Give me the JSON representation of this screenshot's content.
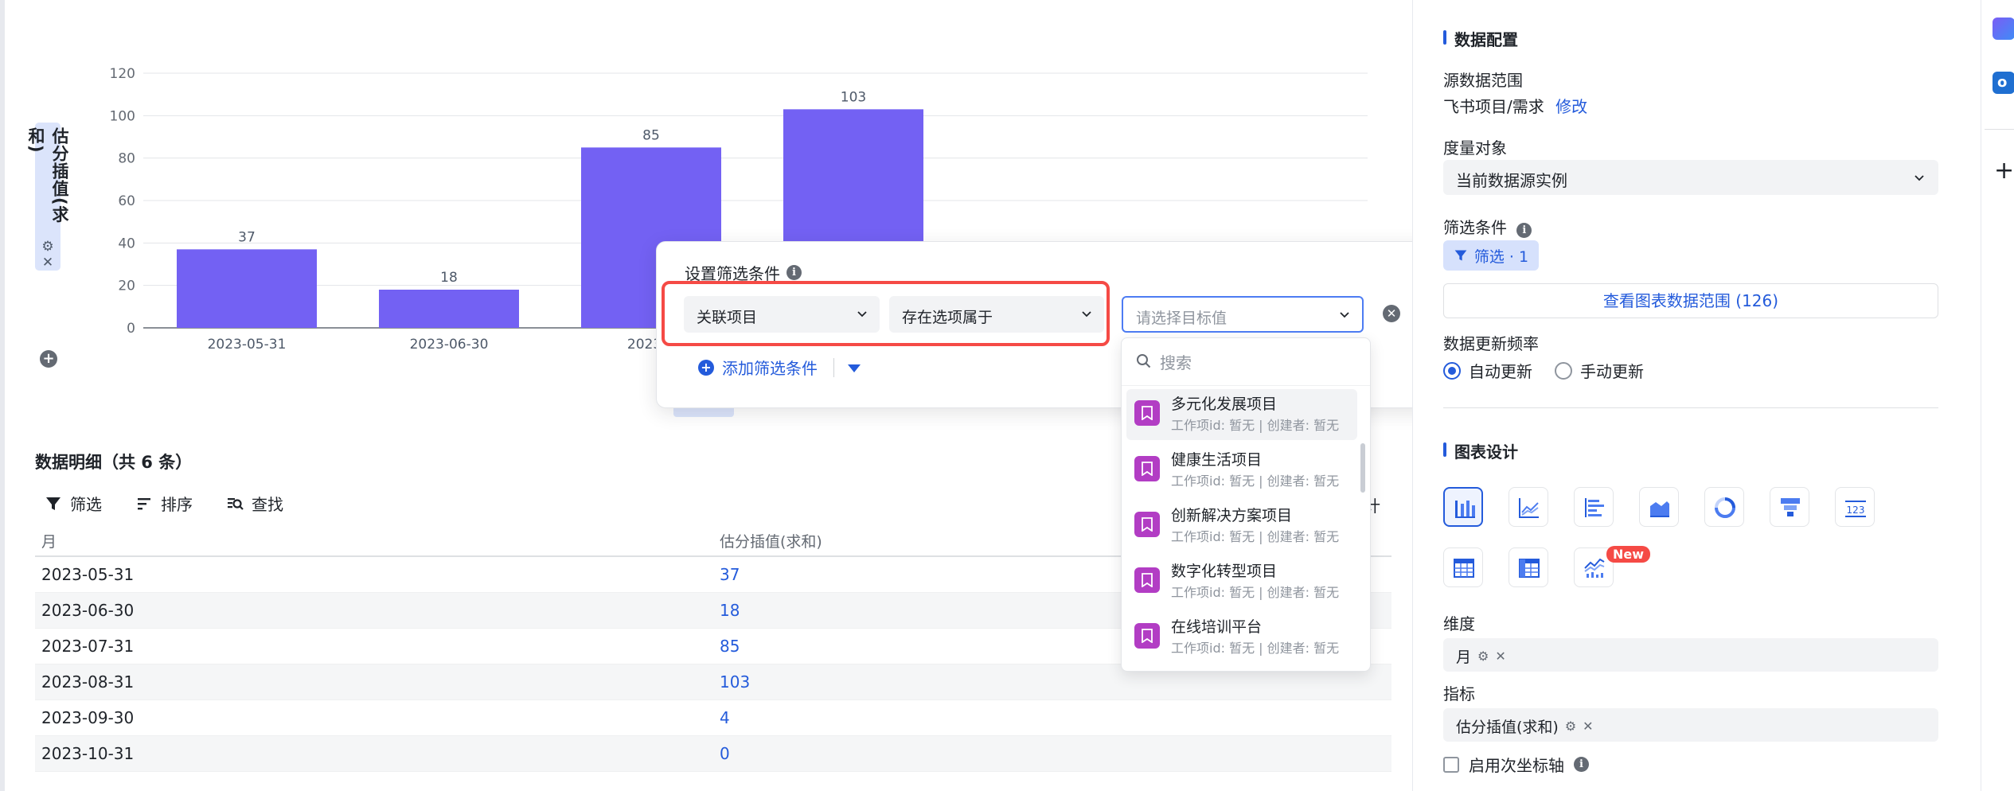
{
  "chart_data": {
    "type": "bar",
    "categories": [
      "2023-05-31",
      "2023-06-30",
      "2023-07-31",
      "2023-08-31"
    ],
    "values": [
      37,
      18,
      85,
      103
    ],
    "visible_category_labels": [
      "2023-05-31",
      "2023-06-30",
      "2023-0"
    ],
    "ylabel": "估分插值(求和)",
    "yticks": [
      0,
      20,
      40,
      60,
      80,
      100,
      120
    ],
    "ylim": [
      0,
      120
    ],
    "grid": true,
    "color": "#7361f3"
  },
  "chart": {
    "y_axis_label": "估分插值(求和)",
    "y_axis_icons": [
      "gear-icon",
      "close-icon"
    ]
  },
  "detail": {
    "title": "数据明细（共 6 条）",
    "toolbar": {
      "filter": "筛选",
      "sort": "排序",
      "find": "查找"
    },
    "partial_right": "计",
    "columns": [
      "月",
      "估分插值(求和)"
    ],
    "rows": [
      {
        "month": "2023-05-31",
        "value": "37"
      },
      {
        "month": "2023-06-30",
        "value": "18"
      },
      {
        "month": "2023-07-31",
        "value": "85"
      },
      {
        "month": "2023-08-31",
        "value": "103"
      },
      {
        "month": "2023-09-30",
        "value": "4"
      },
      {
        "month": "2023-10-31",
        "value": "0"
      }
    ]
  },
  "filter_popup": {
    "title": "设置筛选条件",
    "field": "关联项目",
    "operator": "存在选项属于",
    "target_placeholder": "请选择目标值",
    "add_label": "添加筛选条件",
    "partial_right": "条件"
  },
  "dropdown": {
    "search_placeholder": "搜索",
    "items": [
      {
        "name": "多元化发展项目",
        "sub": "工作项id: 暂无 | 创建者: 暂无"
      },
      {
        "name": "健康生活项目",
        "sub": "工作项id: 暂无 | 创建者: 暂无"
      },
      {
        "name": "创新解决方案项目",
        "sub": "工作项id: 暂无 | 创建者: 暂无"
      },
      {
        "name": "数字化转型项目",
        "sub": "工作项id: 暂无 | 创建者: 暂无"
      },
      {
        "name": "在线培训平台",
        "sub": "工作项id: 暂无 | 创建者: 暂无"
      }
    ]
  },
  "panel": {
    "data_config_title": "数据配置",
    "source_range_label": "源数据范围",
    "source_range_value": "飞书项目/需求",
    "modify": "修改",
    "measure_label": "度量对象",
    "measure_value": "当前数据源实例",
    "filter_label": "筛选条件",
    "filter_tag": "筛选 · 1",
    "view_range": "查看图表数据范围 (126)",
    "update_freq_label": "数据更新频率",
    "auto_update": "自动更新",
    "manual_update": "手动更新",
    "chart_design_title": "图表设计",
    "new_badge": "New",
    "dimension_label": "维度",
    "dimension_value": "月",
    "metric_label": "指标",
    "metric_value": "估分插值(求和)",
    "secondary_axis": "启用次坐标轴"
  },
  "colors": {
    "accent": "#245bdb",
    "bar": "#7361f3",
    "danger": "#f54a45",
    "project_icon": "#b23dc4"
  }
}
